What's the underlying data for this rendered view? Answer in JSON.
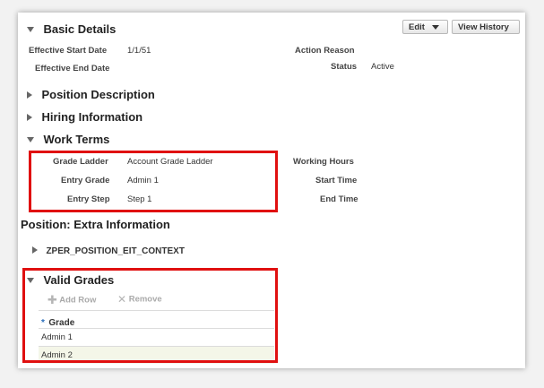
{
  "sections": {
    "basic_details": "Basic Details",
    "position_description": "Position Description",
    "hiring_information": "Hiring Information",
    "work_terms": "Work Terms",
    "extra_information": "Position: Extra Information",
    "eit_context": "ZPER_POSITION_EIT_CONTEXT",
    "valid_grades": "Valid Grades"
  },
  "toolbar": {
    "edit_label": "Edit",
    "view_history_label": "View History"
  },
  "basic": {
    "start_date_label": "Effective Start Date",
    "start_date_value": "1/1/51",
    "end_date_label": "Effective End Date",
    "action_reason_label": "Action Reason",
    "status_label": "Status",
    "status_value": "Active"
  },
  "work_terms": {
    "grade_ladder_label": "Grade Ladder",
    "grade_ladder_value": "Account Grade Ladder",
    "entry_grade_label": "Entry Grade",
    "entry_grade_value": "Admin 1",
    "entry_step_label": "Entry Step",
    "entry_step_value": "Step 1",
    "working_hours_label": "Working Hours",
    "start_time_label": "Start Time",
    "end_time_label": "End Time"
  },
  "grades": {
    "add_row_label": "Add Row",
    "remove_label": "Remove",
    "required_marker": "*",
    "column_header": "Grade",
    "rows": [
      "Admin 1",
      "Admin 2"
    ]
  },
  "icons": {
    "expanded": "triangle-down",
    "collapsed": "triangle-right",
    "add": "plus",
    "remove": "x-mark",
    "dropdown": "caret-down"
  },
  "colors": {
    "highlight_box": "#e01010",
    "selected_row": "#f4f6e8"
  }
}
